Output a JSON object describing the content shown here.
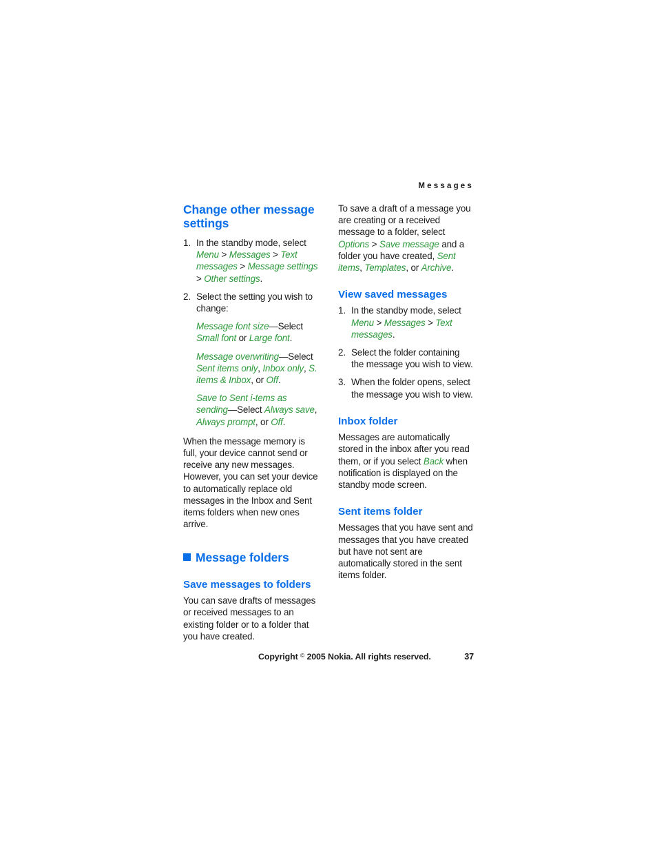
{
  "page": {
    "running_head": "Messages",
    "number": "37",
    "heading_color": "#0b6fe8",
    "ui_term_color": "#2e9a3c",
    "body_color": "#1a1a1a",
    "background": "#ffffff"
  },
  "left_column": {
    "heading_1": "Change other message settings",
    "steps": {
      "step1": {
        "text_a": "In the standby mode, select ",
        "ui_1": "Menu",
        "sep_1": " > ",
        "ui_2": "Messages",
        "sep_2": " > ",
        "ui_3": "Text messages",
        "sep_3": " > ",
        "ui_4": "Message settings",
        "sep_4": " > ",
        "ui_5": "Other settings",
        "text_end": "."
      },
      "step2": {
        "text": "Select the setting you wish to change:",
        "sub_1": {
          "ui_1": "Message font size",
          "dash": "—",
          "text_a": "Select ",
          "ui_2": "Small font",
          "text_b": " or ",
          "ui_3": "Large font",
          "text_end": "."
        },
        "sub_2": {
          "ui_1": "Message overwriting",
          "dash": "—",
          "text_a": "Select ",
          "ui_2": "Sent items only",
          "comma_1": ", ",
          "ui_3": "Inbox only",
          "comma_2": ", ",
          "ui_4": "S. items & Inbox",
          "text_b": ", or ",
          "ui_5": "Off",
          "text_end": "."
        },
        "sub_3": {
          "ui_1": "Save to Sent i-tems as sending",
          "dash": "—",
          "text_a": "Select ",
          "ui_2": "Always save",
          "comma_1": ", ",
          "ui_3": "Always prompt",
          "text_b": ", or ",
          "ui_4": "Off",
          "text_end": "."
        }
      }
    },
    "paragraph_memory": "When the message memory is full, your device cannot send or receive any new messages. However, you can set your device to automatically replace old messages in the Inbox and Sent items folders when new ones arrive.",
    "heading_2": "Message folders",
    "heading_2_bullet": "square-bullet",
    "heading_3": "Save messages to folders",
    "paragraph_save": "You can save drafts of messages or received messages to an existing folder or to a folder that you have created."
  },
  "right_column": {
    "paragraph_draft": {
      "text_a": "To save a draft of a message you are creating or a received message to a folder, select ",
      "ui_1": "Options",
      "sep_1": " > ",
      "ui_2": "Save message",
      "text_b": " and a folder you have created, ",
      "ui_3": "Sent items",
      "comma_1": ", ",
      "ui_4": "Templates",
      "text_c": ", or ",
      "ui_5": "Archive",
      "text_end": "."
    },
    "heading_1": "View saved messages",
    "steps": {
      "step1": {
        "text_a": "In the standby mode, select ",
        "ui_1": "Menu",
        "sep_1": " > ",
        "ui_2": "Messages",
        "sep_2": " > ",
        "ui_3": "Text messages",
        "text_end": "."
      },
      "step2": "Select the folder containing the message you wish to view.",
      "step3": "When the folder opens, select the message you wish to view."
    },
    "heading_2": "Inbox folder",
    "paragraph_inbox": {
      "text_a": "Messages are automatically stored in the inbox after you read them, or if you select ",
      "ui_1": "Back",
      "text_b": " when notification is displayed on the standby mode screen."
    },
    "heading_3": "Sent items folder",
    "paragraph_sent": "Messages that you have sent and messages that you have created but have not sent are automatically stored in the sent items folder."
  },
  "footer": {
    "copyright_prefix": "Copyright ",
    "copyright_symbol": "©",
    "copyright_rest": " 2005 Nokia. All rights reserved.",
    "page_number": "37"
  }
}
